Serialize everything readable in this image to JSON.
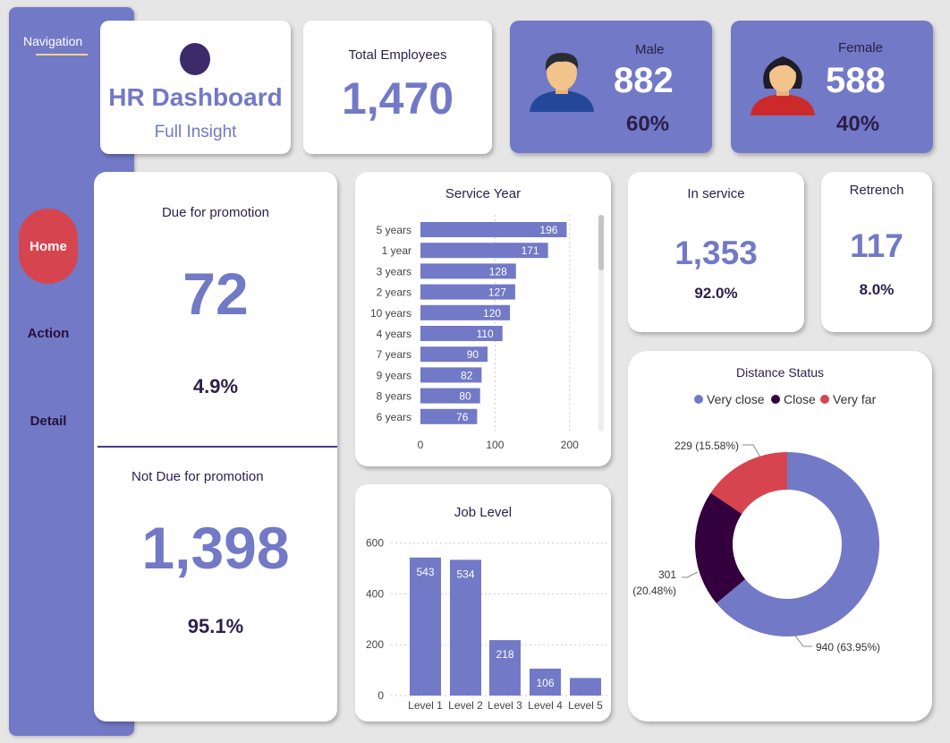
{
  "nav": {
    "title": "Navigation",
    "items": [
      {
        "label": "Home"
      },
      {
        "label": "Action"
      },
      {
        "label": "Detail"
      }
    ]
  },
  "header": {
    "title": "HR Dashboard",
    "subtitle": "Full Insight"
  },
  "total": {
    "label": "Total Employees",
    "value": "1,470"
  },
  "male": {
    "label": "Male",
    "value": "882",
    "pct": "60%"
  },
  "female": {
    "label": "Female",
    "value": "588",
    "pct": "40%"
  },
  "promotion": {
    "due_label": "Due for promotion",
    "due_value": "72",
    "due_pct": "4.9%",
    "notdue_label": "Not Due for promotion",
    "notdue_value": "1,398",
    "notdue_pct": "95.1%"
  },
  "in_service": {
    "label": "In service",
    "value": "1,353",
    "pct": "92.0%"
  },
  "retrench": {
    "label": "Retrench",
    "value": "117",
    "pct": "8.0%"
  },
  "colors": {
    "accent": "#7279c6",
    "close": "#33003d",
    "very_far": "#d6454f",
    "home": "#d6454f"
  },
  "chart_data": [
    {
      "type": "bar",
      "orientation": "horizontal",
      "title": "Service Year",
      "categories": [
        "5 years",
        "1 year",
        "3 years",
        "2 years",
        "10 years",
        "4 years",
        "7 years",
        "9 years",
        "8 years",
        "6 years"
      ],
      "values": [
        196,
        171,
        128,
        127,
        120,
        110,
        90,
        82,
        80,
        76
      ],
      "xticks": [
        "0",
        "100",
        "200"
      ],
      "xlim": [
        0,
        210
      ]
    },
    {
      "type": "bar",
      "title": "Job Level",
      "categories": [
        "Level 1",
        "Level 2",
        "Level 3",
        "Level 4",
        "Level 5"
      ],
      "values": [
        543,
        534,
        218,
        106,
        69
      ],
      "data_labels": [
        "543",
        "534",
        "218",
        "106",
        ""
      ],
      "yticks": [
        "0",
        "200",
        "400",
        "600"
      ],
      "ylim": [
        0,
        620
      ]
    },
    {
      "type": "pie",
      "title": "Distance Status",
      "legend_position": "top",
      "series": [
        {
          "name": "Very close",
          "value": 940,
          "label": "940 (63.95%)",
          "color": "#7279c6"
        },
        {
          "name": "Close",
          "value": 301,
          "label_line1": "301",
          "label_line2": "(20.48%)",
          "color": "#33003d"
        },
        {
          "name": "Very far",
          "value": 229,
          "label": "229 (15.58%)",
          "color": "#d6454f"
        }
      ]
    }
  ]
}
